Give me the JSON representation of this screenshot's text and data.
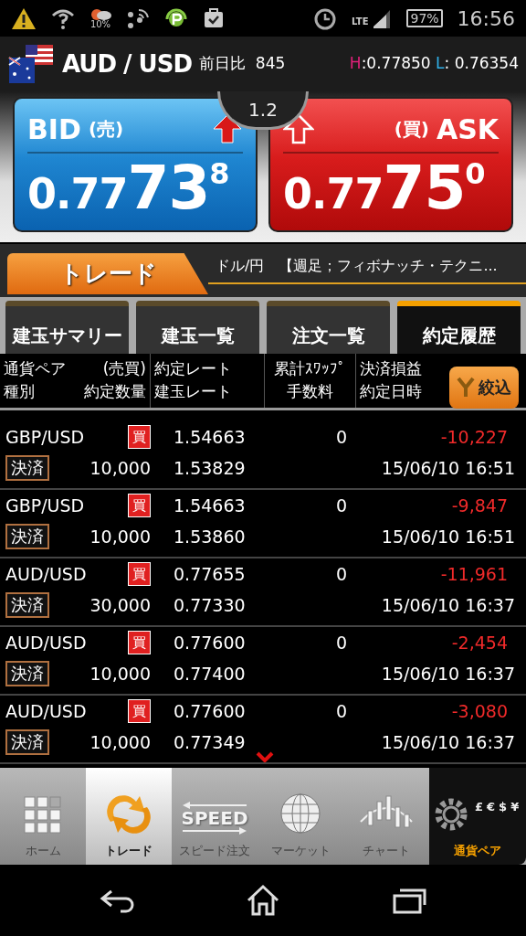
{
  "status_bar": {
    "weather_percent": "10%",
    "network": "LTE",
    "battery": "97%",
    "time": "16:56"
  },
  "header": {
    "pair": "AUD / USD",
    "change_label": "前日比",
    "change": "845",
    "high_label": "H",
    "high": ":0.77850",
    "low_label": "L",
    "low": ": 0.76354"
  },
  "quote": {
    "spread": "1.2",
    "bid": {
      "label": "BID",
      "side": "(売)",
      "rising": true,
      "filled": true,
      "main": "0.77",
      "big": "73",
      "small": "8"
    },
    "ask": {
      "label": "ASK",
      "side": "(買)",
      "rising": true,
      "filled": false,
      "main": "0.77",
      "big": "75",
      "small": "0"
    }
  },
  "section": {
    "title": "トレード",
    "ticker": "ドル/円　【週足；フィボナッチ・テクニ..."
  },
  "tabs": [
    {
      "label": "建玉サマリー",
      "selected": false
    },
    {
      "label": "建玉一覧",
      "selected": false
    },
    {
      "label": "注文一覧",
      "selected": false
    },
    {
      "label": "約定履歴",
      "selected": true
    }
  ],
  "columns": [
    [
      "通貨ペア",
      "(売買)",
      "種別",
      "約定数量"
    ],
    [
      "約定レート",
      "建玉レート"
    ],
    [
      "累計ｽﾜｯﾌﾟ",
      "手数料"
    ],
    [
      "決済損益",
      "約定日時"
    ]
  ],
  "filter_button": "絞込",
  "rows": [
    {
      "pair": "GBP/USD",
      "side": "買",
      "type": "決済",
      "quantity": "10,000",
      "rate": "1.54663",
      "position_rate": "1.53829",
      "swap": "0",
      "pnl": "-10,227",
      "datetime": "15/06/10 16:51"
    },
    {
      "pair": "GBP/USD",
      "side": "買",
      "type": "決済",
      "quantity": "10,000",
      "rate": "1.54663",
      "position_rate": "1.53860",
      "swap": "0",
      "pnl": "-9,847",
      "datetime": "15/06/10 16:51"
    },
    {
      "pair": "AUD/USD",
      "side": "買",
      "type": "決済",
      "quantity": "30,000",
      "rate": "0.77655",
      "position_rate": "0.77330",
      "swap": "0",
      "pnl": "-11,961",
      "datetime": "15/06/10 16:37"
    },
    {
      "pair": "AUD/USD",
      "side": "買",
      "type": "決済",
      "quantity": "10,000",
      "rate": "0.77600",
      "position_rate": "0.77400",
      "swap": "0",
      "pnl": "-2,454",
      "datetime": "15/06/10 16:37"
    },
    {
      "pair": "AUD/USD",
      "side": "買",
      "type": "決済",
      "quantity": "10,000",
      "rate": "0.77600",
      "position_rate": "0.77349",
      "swap": "0",
      "pnl": "-3,080",
      "datetime": "15/06/10 16:37"
    }
  ],
  "bottom_nav": [
    {
      "kind": "home",
      "label": "ホーム",
      "selected": false
    },
    {
      "kind": "trade",
      "label": "トレード",
      "selected": true
    },
    {
      "kind": "speed",
      "label": "スピード注文",
      "icon_text": "SPEED",
      "selected": false
    },
    {
      "kind": "market",
      "label": "マーケット",
      "selected": false
    },
    {
      "kind": "chart",
      "label": "チャート",
      "selected": false
    },
    {
      "kind": "pairs",
      "label": "通貨ペア",
      "symbols": [
        "£",
        "€",
        "$",
        "¥"
      ],
      "selected": false
    }
  ]
}
